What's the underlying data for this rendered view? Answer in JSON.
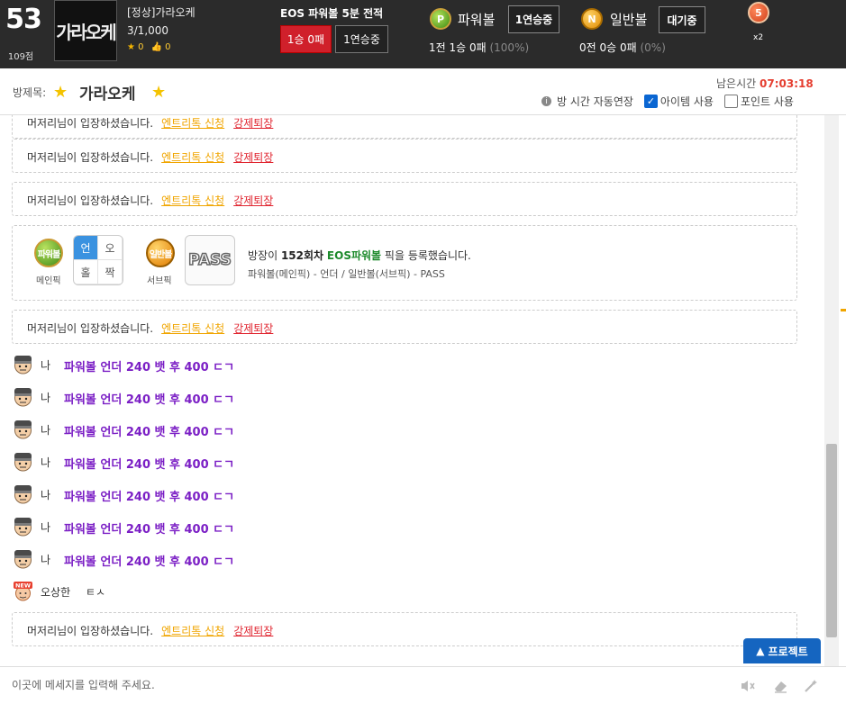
{
  "header": {
    "level": "53",
    "points": "109점",
    "thumb_text": "가라오케",
    "room_name": "[정상]가라오케",
    "room_count": "3/1,000",
    "star_count": "0",
    "like_count": "0",
    "mode_title": "EOS 파워볼 5분 전적",
    "mode_record": "1승 0패",
    "mode_streak": "1연승중",
    "powerball": {
      "icon": "P",
      "label": "파워볼",
      "status": "1연승중",
      "rec_main": "1전 1승 0패",
      "rec_pct": "(100%)"
    },
    "normalball": {
      "icon": "N",
      "label": "일반볼",
      "status": "대기중",
      "rec_main": "0전 0승 0패",
      "rec_pct": "(0%)"
    },
    "multiplier_icon": "5",
    "multiplier": "x2"
  },
  "titlebar": {
    "prefix": "방제목:",
    "name": "가라오케",
    "remain_label": "남은시간",
    "remain_time": "07:03:18",
    "auto_extend": "방 시간 자동연장",
    "use_item": "아이템 사용",
    "use_item_checked": true,
    "use_point": "포인트 사용",
    "use_point_checked": false
  },
  "notices": [
    {
      "who": "머저리",
      "suffix": "님이 입장하셨습니다.",
      "entry": "엔트리톡 신청",
      "kick": "강제퇴장"
    },
    {
      "who": "머저리",
      "suffix": "님이 입장하셨습니다.",
      "entry": "엔트리톡 신청",
      "kick": "강제퇴장"
    },
    {
      "who": "머저리",
      "suffix": "님이 입장하셨습니다.",
      "entry": "엔트리톡 신청",
      "kick": "강제퇴장"
    },
    {
      "who": "머저리",
      "suffix": "님이 입장하셨습니다.",
      "entry": "엔트리톡 신청",
      "kick": "강제퇴장"
    },
    {
      "who": "머저리",
      "suffix": "님이 입장하셨습니다.",
      "entry": "엔트리톡 신청",
      "kick": "강제퇴장"
    }
  ],
  "pick": {
    "main_ball": "파워볼",
    "main_cap": "메인픽",
    "grid": [
      "언",
      "오",
      "홀",
      "짝"
    ],
    "sub_ball": "일반볼",
    "sub_cap": "서브픽",
    "pass": "PASS",
    "msg_prefix": "방장이",
    "round": "152회차",
    "game": "EOS파워볼",
    "msg_suffix": "픽을 등록했습니다.",
    "sub_line": "파워볼(메인픽) - 언더 / 일반볼(서브픽) - PASS"
  },
  "my_messages": [
    {
      "who": "나",
      "text": "파워볼 언더 240 뱃 후 400 ㄷㄱ"
    },
    {
      "who": "나",
      "text": "파워볼 언더 240 뱃 후 400 ㄷㄱ"
    },
    {
      "who": "나",
      "text": "파워볼 언더 240 뱃 후 400 ㄷㄱ"
    },
    {
      "who": "나",
      "text": "파워볼 언더 240 뱃 후 400 ㄷㄱ"
    },
    {
      "who": "나",
      "text": "파워볼 언더 240 뱃 후 400 ㄷㄱ"
    },
    {
      "who": "나",
      "text": "파워볼 언더 240 뱃 후 400 ㄷㄱ"
    },
    {
      "who": "나",
      "text": "파워볼 언더 240 뱃 후 400 ㄷㄱ"
    }
  ],
  "other_message": {
    "badge": "NEW",
    "who": "오상한",
    "text": "ㅌㅅ"
  },
  "project_button": "프로젝트",
  "input": {
    "placeholder": "이곳에 메세지를 입력해 주세요."
  },
  "icons": [
    "star-icon",
    "thumbs-up-icon",
    "info-icon",
    "checkbox-icon",
    "mute-icon",
    "eraser-icon",
    "magic-wand-icon",
    "caret-up-icon",
    "avatar-icon"
  ]
}
